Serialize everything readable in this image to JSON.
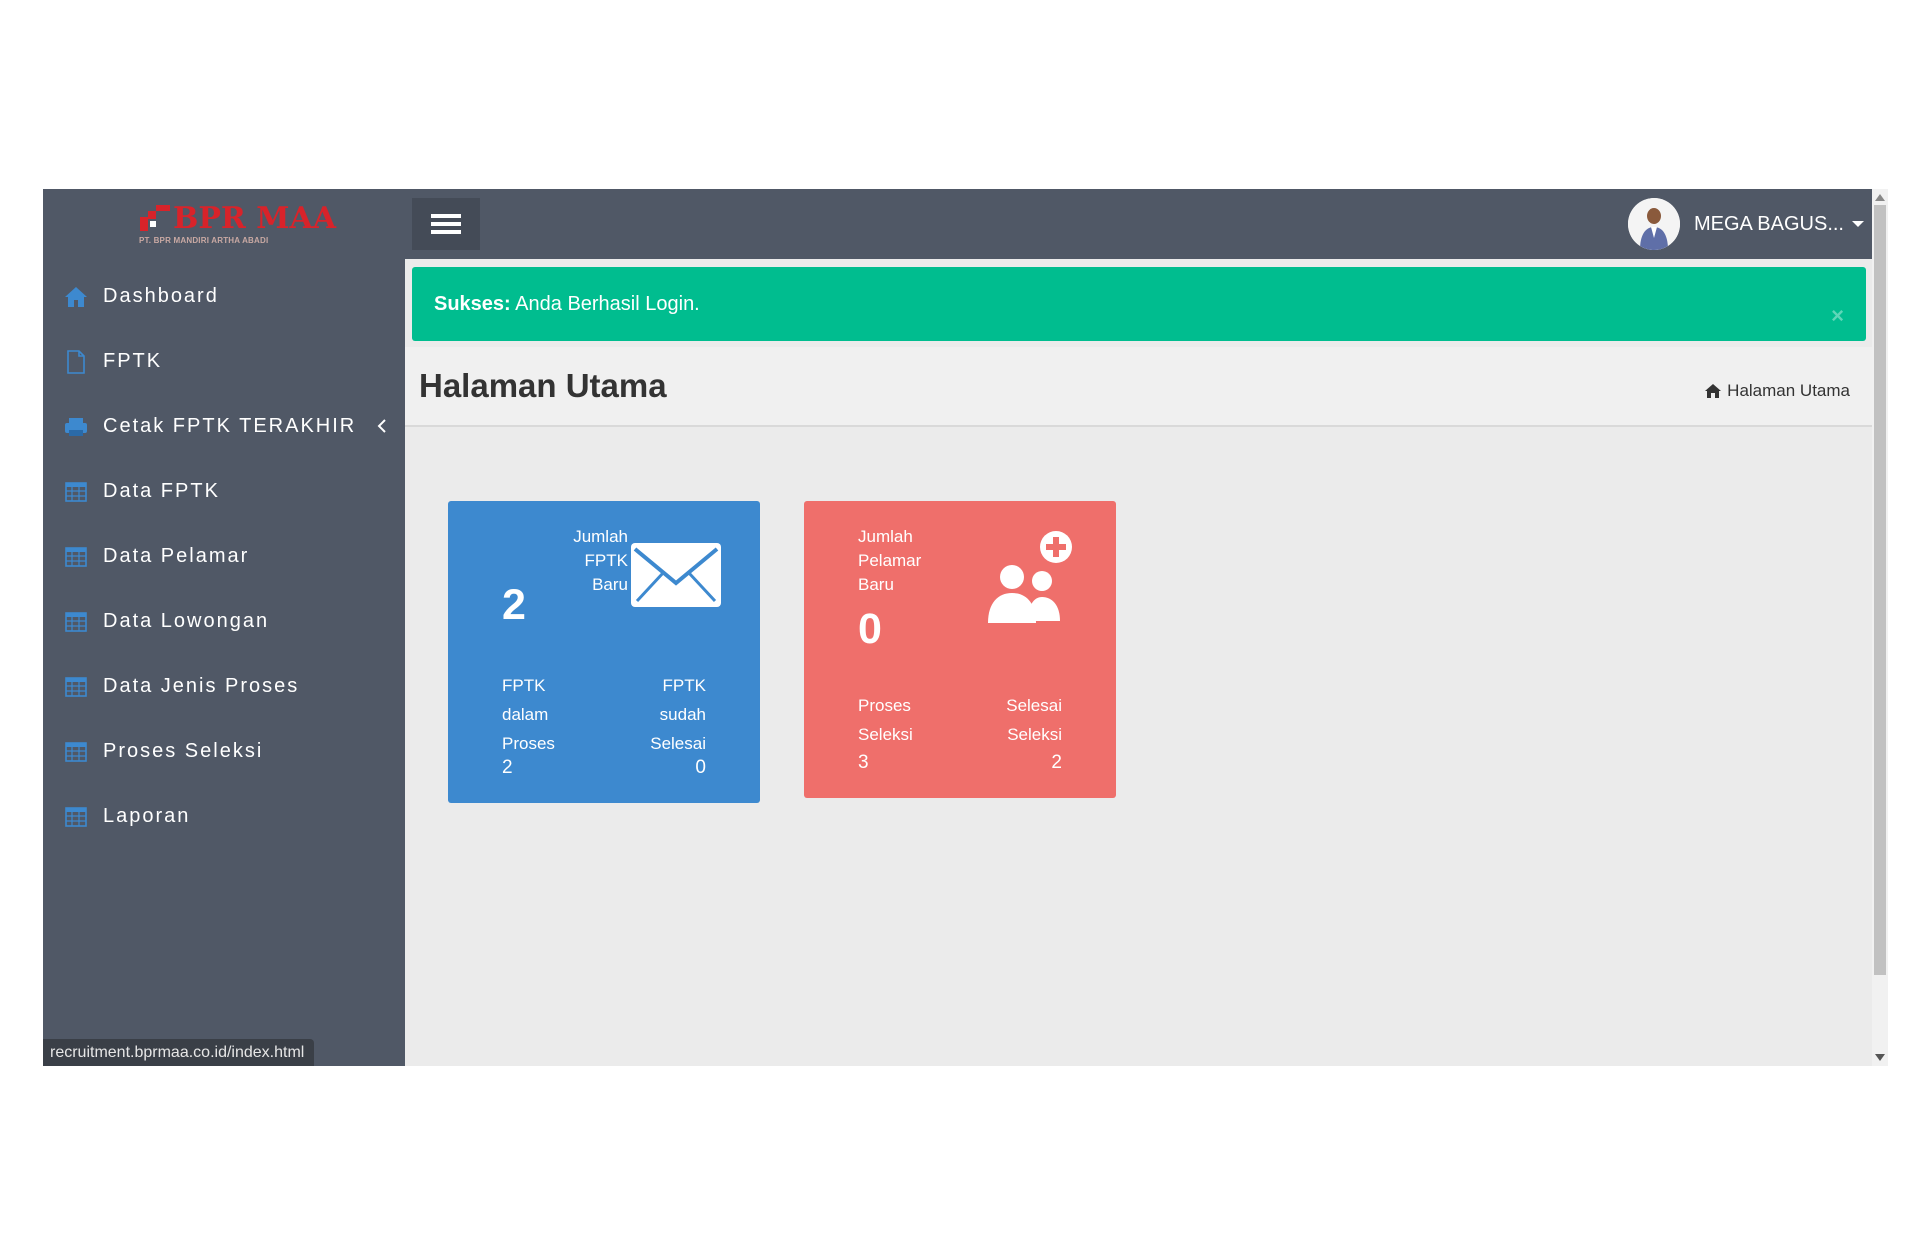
{
  "logo": {
    "text": "BPR MAA",
    "subtext": "PT. BPR MANDIRI ARTHA ABADI"
  },
  "sidebar": {
    "items": [
      {
        "label": "Dashboard",
        "icon": "home-icon"
      },
      {
        "label": "FPTK",
        "icon": "file-icon"
      },
      {
        "label": "Cetak FPTK TERAKHIR",
        "icon": "printer-icon",
        "has_submenu": true
      },
      {
        "label": "Data FPTK",
        "icon": "table-icon"
      },
      {
        "label": "Data Pelamar",
        "icon": "table-icon"
      },
      {
        "label": "Data Lowongan",
        "icon": "table-icon"
      },
      {
        "label": "Data Jenis Proses",
        "icon": "table-icon"
      },
      {
        "label": "Proses Seleksi",
        "icon": "table-icon"
      },
      {
        "label": "Laporan",
        "icon": "table-icon"
      }
    ]
  },
  "status_url": "recruitment.bprmaa.co.id/index.html",
  "topbar": {
    "user_name": "MEGA BAGUS..."
  },
  "alert": {
    "strong": "Sukses:",
    "message": " Anda Berhasil Login.",
    "close": "×"
  },
  "page": {
    "title": "Halaman Utama",
    "breadcrumb": "Halaman Utama"
  },
  "boxes": {
    "fptk": {
      "label_line1": "Jumlah",
      "label_line2": "FPTK Baru",
      "count": "2",
      "left_sub": [
        "FPTK",
        "dalam",
        "Proses"
      ],
      "left_value": "2",
      "right_sub": [
        "FPTK",
        "sudah",
        "Selesai"
      ],
      "right_value": "0",
      "icon": "envelope-icon",
      "color": "#3d89cf"
    },
    "pelamar": {
      "label_line1": "Jumlah",
      "label_line2": "Pelamar",
      "label_line3": "Baru",
      "count": "0",
      "left_sub": [
        "Proses",
        "Seleksi"
      ],
      "left_value": "3",
      "right_sub": [
        "Selesai",
        "Seleksi"
      ],
      "right_value": "2",
      "icon": "add-users-icon",
      "color": "#ef6f6b"
    }
  },
  "colors": {
    "sidebar": "#505866",
    "alert": "#00bd8f",
    "accent_icon": "#3d89cf"
  }
}
